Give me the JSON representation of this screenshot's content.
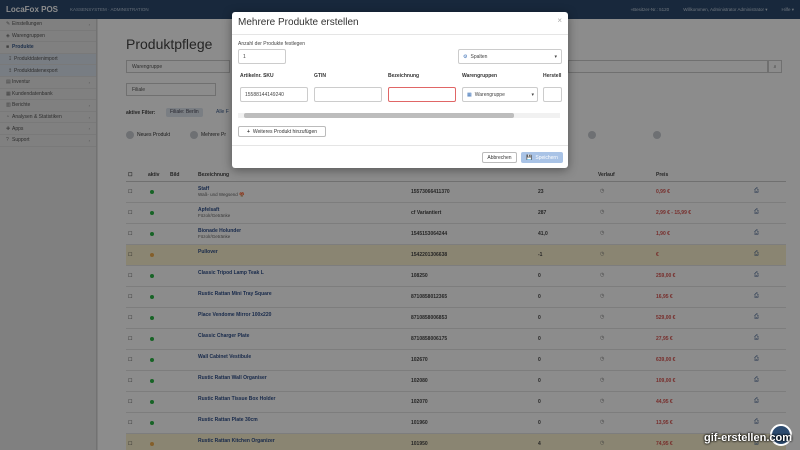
{
  "topbar": {
    "brand": "LocaFox POS",
    "subtitle": "KASSENSYSTEM · ADMINISTRATION",
    "right": [
      "«Besitzer-Nr.: 5120",
      "Willkommen, Administrator Administrator ▾",
      "Hilfe ▾"
    ]
  },
  "sidebar": [
    {
      "icon": "wrench-icon",
      "glyph": "✎",
      "label": "Einstellungen",
      "chev": "›"
    },
    {
      "icon": "tag-icon",
      "glyph": "◈",
      "label": "Warengruppen",
      "chev": ""
    },
    {
      "icon": "box-icon",
      "glyph": "■",
      "label": "Produkte",
      "chev": "",
      "active": true
    },
    {
      "icon": "import-icon",
      "glyph": "↧",
      "label": "Produktdatenimport",
      "chev": "",
      "sub": true
    },
    {
      "icon": "export-icon",
      "glyph": "↥",
      "label": "Produktdatenexport",
      "chev": "",
      "sub": true
    },
    {
      "icon": "inventory-icon",
      "glyph": "▤",
      "label": "Inventur",
      "chev": "›"
    },
    {
      "icon": "customers-icon",
      "glyph": "▦",
      "label": "Kundendatenbank",
      "chev": ""
    },
    {
      "icon": "reports-icon",
      "glyph": "▥",
      "label": "Berichte",
      "chev": "›"
    },
    {
      "icon": "analytics-icon",
      "glyph": "◔",
      "label": "Analysen & Statistiken",
      "chev": "›"
    },
    {
      "icon": "apps-icon",
      "glyph": "✚",
      "label": "Apps",
      "chev": "›"
    },
    {
      "icon": "support-icon",
      "glyph": "?",
      "label": "Support",
      "chev": "›"
    }
  ],
  "page": {
    "title": "Produktpflege",
    "filter_warengruppe": "Warengruppe",
    "filter_filiale": "Filiale",
    "filter_label": "aktive Filter:",
    "chip1": "Filiale: Berlin",
    "chip2": "Alle F",
    "btn_new": "Neues Produkt",
    "btn_multi": "Mehrere Pr"
  },
  "table": {
    "headers": {
      "aktiv": "aktiv",
      "bild": "Bild",
      "bezeichnung": "Bezeichnung",
      "verlauf": "Verlauf",
      "preis": "Preis"
    },
    "rows": [
      {
        "name": "Staff",
        "sub": "Waß- und Wegsend 🍄",
        "code": "15573066411370",
        "qty": "23",
        "price": "0,99 €",
        "dot": "#2ab446",
        "hl": false
      },
      {
        "name": "Apfelsaft",
        "sub": "Fözolr/Getränke",
        "code": "cf Variantiert",
        "qty": "287",
        "price": "2,99 € - 15,99 €",
        "dot": "#2ab446",
        "hl": false
      },
      {
        "name": "Bionade Holunder",
        "sub": "Fözolr/Getränke",
        "code": "1545153064244",
        "qty": "41,0",
        "price": "1,90 €",
        "dot": "#2ab446",
        "hl": false
      },
      {
        "name": "Pullover",
        "sub": "",
        "code": "1542201306638",
        "qty": "-1",
        "price": "€",
        "dot": "#f0ad4e",
        "hl": true
      },
      {
        "name": "Classic Tripod Lamp Teak L",
        "sub": "",
        "code": "108250",
        "qty": "0",
        "price": "259,00 €",
        "dot": "#2ab446",
        "hl": false
      },
      {
        "name": "Rustic Rattan Mini Tray Square",
        "sub": "",
        "code": "8710858012365",
        "qty": "0",
        "price": "16,95 €",
        "dot": "#2ab446",
        "hl": false
      },
      {
        "name": "Place Vendome Mirror 100x220",
        "sub": "",
        "code": "8710858006853",
        "qty": "0",
        "price": "529,00 €",
        "dot": "#2ab446",
        "hl": false
      },
      {
        "name": "Classic Charger Plate",
        "sub": "",
        "code": "8710858006175",
        "qty": "0",
        "price": "27,95 €",
        "dot": "#2ab446",
        "hl": false
      },
      {
        "name": "Wall Cabinet Vestibule",
        "sub": "",
        "code": "102670",
        "qty": "0",
        "price": "639,00 €",
        "dot": "#2ab446",
        "hl": false
      },
      {
        "name": "Rustic Rattan Wall Organiser",
        "sub": "",
        "code": "102080",
        "qty": "0",
        "price": "109,00 €",
        "dot": "#2ab446",
        "hl": false
      },
      {
        "name": "Rustic Rattan Tissue Box Holder",
        "sub": "",
        "code": "102070",
        "qty": "0",
        "price": "44,95 €",
        "dot": "#2ab446",
        "hl": false
      },
      {
        "name": "Rustic Rattan Plate 30cm",
        "sub": "",
        "code": "101960",
        "qty": "0",
        "price": "13,95 €",
        "dot": "#2ab446",
        "hl": false
      },
      {
        "name": "Rustic Rattan Kitchen Organizer",
        "sub": "",
        "code": "101950",
        "qty": "4",
        "price": "74,95 €",
        "dot": "#f0ad4e",
        "hl": true
      }
    ]
  },
  "modal": {
    "title": "Mehrere Produkte erstellen",
    "close": "×",
    "count_label": "Anzahl der Produkte festlegen",
    "count_value": "1",
    "columns_btn": "Spalten",
    "col_sku": "Artikelnr. SKU",
    "col_gtin": "GTIN",
    "col_bez": "Bezeichnung",
    "col_wg": "Warengruppen",
    "col_hersteller": "Herstell",
    "sku_value": "15588144149240",
    "wg_value": "Warengruppe",
    "add_btn": "Weiteres Produkt hinzufügen",
    "cancel": "Abbrechen",
    "save": "Speichern"
  },
  "watermark": "gif-erstellen.com"
}
